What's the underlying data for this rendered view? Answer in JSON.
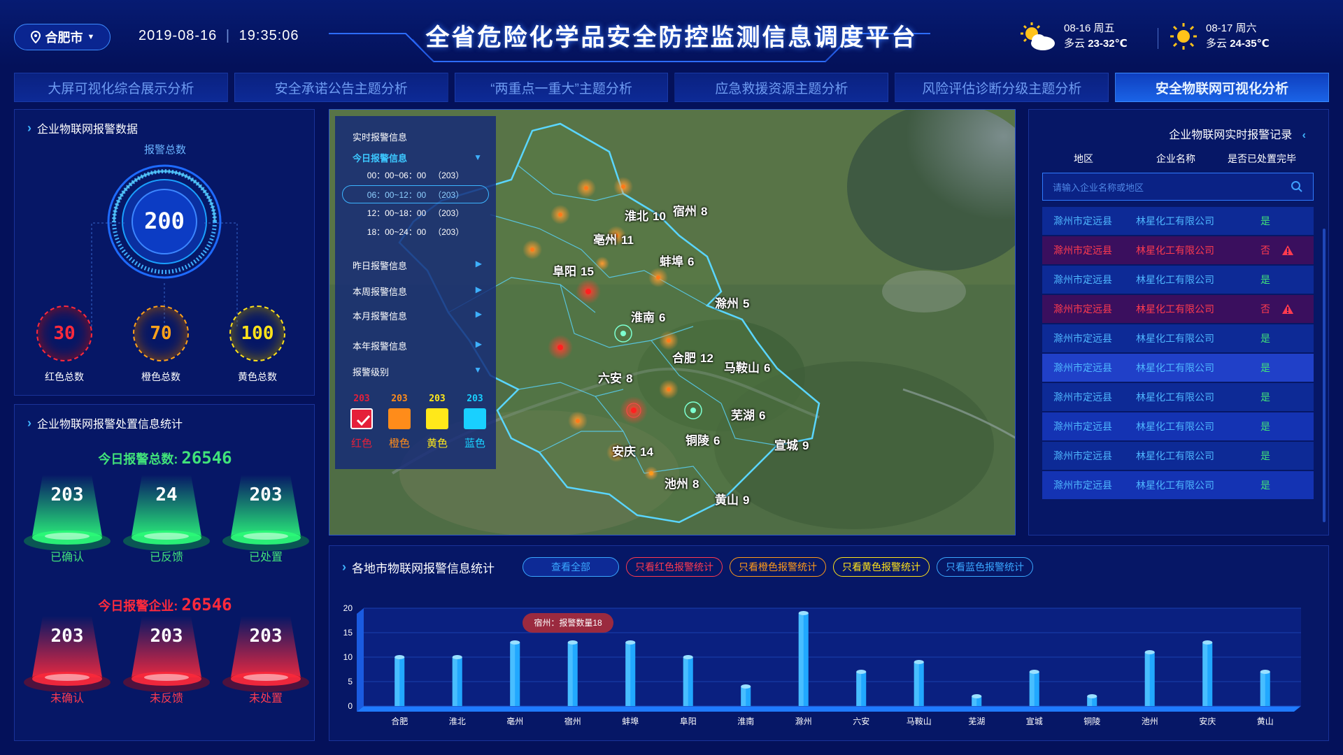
{
  "header": {
    "city": "合肥市",
    "date": "2019-08-16",
    "time": "19:35:06",
    "title": "全省危险化学品安全防控监测信息调度平台",
    "weather": [
      {
        "date": "08-16 周五",
        "cond": "多云",
        "temp": "23-32℃",
        "icon": "partly-cloudy-icon"
      },
      {
        "date": "08-17 周六",
        "cond": "多云",
        "temp": "24-35℃",
        "icon": "sun-icon"
      }
    ]
  },
  "nav": {
    "tabs": [
      {
        "label": "大屏可视化综合展示分析"
      },
      {
        "label": "安全承诺公告主题分析"
      },
      {
        "label": "“两重点一重大”主题分析"
      },
      {
        "label": "应急救援资源主题分析"
      },
      {
        "label": "风险评估诊断分级主题分析"
      },
      {
        "label": "安全物联网可视化分析",
        "active": true
      }
    ]
  },
  "alarm_panel": {
    "title": "企业物联网报警数据",
    "total_label": "报警总数",
    "total": "200",
    "red": {
      "value": "30",
      "label": "红色总数",
      "color": "#ff2a3c"
    },
    "orange": {
      "value": "70",
      "label": "橙色总数",
      "color": "#ffa21a"
    },
    "yellow": {
      "value": "100",
      "label": "黄色总数",
      "color": "#ffe21a"
    }
  },
  "handling_panel": {
    "title": "企业物联网报警处置信息统计",
    "today_total_label": "今日报警总数:",
    "today_total": "26546",
    "green": [
      {
        "value": "203",
        "label": "已确认"
      },
      {
        "value": "24",
        "label": "已反馈"
      },
      {
        "value": "203",
        "label": "已处置"
      }
    ],
    "today_ent_label": "今日报警企业:",
    "today_ent": "26546",
    "red": [
      {
        "value": "203",
        "label": "未确认"
      },
      {
        "value": "203",
        "label": "未反馈"
      },
      {
        "value": "203",
        "label": "未处置"
      }
    ]
  },
  "map_legend": {
    "realtime": "实时报警信息",
    "today": "今日报警信息",
    "slots": [
      {
        "range": "00：00~06：00",
        "count": "（203）"
      },
      {
        "range": "06：00~12：00",
        "count": "（203）"
      },
      {
        "range": "12：00~18：00",
        "count": "（203）"
      },
      {
        "range": "18：00~24：00",
        "count": "（203）"
      }
    ],
    "yesterday": "昨日报警信息",
    "week": "本周报警信息",
    "month": "本月报警信息",
    "year": "本年报警信息",
    "level": "报警级别",
    "levels": [
      {
        "num": "203",
        "label": "红色",
        "color": "#e5203a"
      },
      {
        "num": "203",
        "label": "橙色",
        "color": "#ff8c1a"
      },
      {
        "num": "203",
        "label": "黄色",
        "color": "#ffe81a"
      },
      {
        "num": "203",
        "label": "蓝色",
        "color": "#19d0ff"
      }
    ]
  },
  "map_cities": [
    {
      "name": "淮北",
      "count": "10"
    },
    {
      "name": "宿州",
      "count": "8"
    },
    {
      "name": "亳州",
      "count": "11"
    },
    {
      "name": "蚌埠",
      "count": "6"
    },
    {
      "name": "阜阳",
      "count": "15"
    },
    {
      "name": "淮南",
      "count": "6"
    },
    {
      "name": "滁州",
      "count": "5"
    },
    {
      "name": "合肥",
      "count": "12"
    },
    {
      "name": "马鞍山",
      "count": "6"
    },
    {
      "name": "六安",
      "count": "8"
    },
    {
      "name": "芜湖",
      "count": "6"
    },
    {
      "name": "铜陵",
      "count": "6"
    },
    {
      "name": "宣城",
      "count": "9"
    },
    {
      "name": "安庆",
      "count": "14"
    },
    {
      "name": "池州",
      "count": "8"
    },
    {
      "name": "黄山",
      "count": "9"
    }
  ],
  "records": {
    "title": "企业物联网实时报警记录",
    "cols": [
      "地区",
      "企业名称",
      "是否已处置完毕"
    ],
    "search_placeholder": "请输入企业名称或地区",
    "rows": [
      {
        "region": "滁州市定远县",
        "company": "林星化工有限公司",
        "done": "是"
      },
      {
        "region": "滁州市定远县",
        "company": "林星化工有限公司",
        "done": "否"
      },
      {
        "region": "滁州市定远县",
        "company": "林星化工有限公司",
        "done": "是"
      },
      {
        "region": "滁州市定远县",
        "company": "林星化工有限公司",
        "done": "否"
      },
      {
        "region": "滁州市定远县",
        "company": "林星化工有限公司",
        "done": "是"
      },
      {
        "region": "滁州市定远县",
        "company": "林星化工有限公司",
        "done": "是"
      },
      {
        "region": "滁州市定远县",
        "company": "林星化工有限公司",
        "done": "是"
      },
      {
        "region": "滁州市定远县",
        "company": "林星化工有限公司",
        "done": "是"
      },
      {
        "region": "滁州市定远县",
        "company": "林星化工有限公司",
        "done": "是"
      },
      {
        "region": "滁州市定远县",
        "company": "林星化工有限公司",
        "done": "是"
      }
    ]
  },
  "bottom": {
    "title": "各地市物联网报警信息统计",
    "filters": [
      {
        "label": "查看全部",
        "color": "#3aa7ff"
      },
      {
        "label": "只看红色报警统计",
        "color": "#ff3a50"
      },
      {
        "label": "只看橙色报警统计",
        "color": "#ff9a1a"
      },
      {
        "label": "只看黄色报警统计",
        "color": "#ffe21a"
      },
      {
        "label": "只看蓝色报警统计",
        "color": "#3aa7ff"
      }
    ],
    "tooltip": "宿州：报警数量18"
  },
  "chart_data": {
    "type": "bar",
    "categories": [
      "合肥",
      "淮北",
      "亳州",
      "宿州",
      "蚌埠",
      "阜阳",
      "淮南",
      "滁州",
      "六安",
      "马鞍山",
      "芜湖",
      "宣城",
      "铜陵",
      "池州",
      "安庆",
      "黄山"
    ],
    "values": [
      10,
      10,
      13,
      13,
      13,
      10,
      4,
      19,
      7,
      9,
      2,
      7,
      2,
      11,
      13,
      7
    ],
    "ylim": [
      0,
      20
    ],
    "yticks": [
      0,
      5,
      10,
      15,
      20
    ],
    "title": "",
    "xlabel": "",
    "ylabel": ""
  }
}
